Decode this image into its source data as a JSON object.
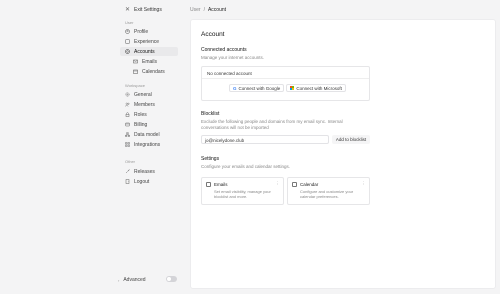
{
  "sidebar": {
    "exit_label": "Exit Settings",
    "user_section": "User",
    "workspace_section": "Workspace",
    "other_section": "Other",
    "items": {
      "profile": "Profile",
      "experience": "Experience",
      "accounts": "Accounts",
      "emails": "Emails",
      "calendars": "Calendars",
      "general": "General",
      "members": "Members",
      "roles": "Roles",
      "billing": "Billing",
      "data_model": "Data model",
      "integrations": "Integrations",
      "releases": "Releases",
      "logout": "Logout"
    },
    "advanced_label": "Advanced",
    "advanced_enabled": false
  },
  "breadcrumb": {
    "parent": "User",
    "separator": "/",
    "current": "Account"
  },
  "main": {
    "title": "Account",
    "connected": {
      "heading": "Connected accounts",
      "description": "Manage your internet accounts.",
      "empty_text": "No connected account",
      "google_button": "Connect with Google",
      "microsoft_button": "Connect with Microsoft"
    },
    "blocklist": {
      "heading": "Blocklist",
      "description_line1": "Exclude the following people and domains from my email sync. Internal",
      "description_line2": "conversations will not be imported",
      "input_value": "jo@nicelydone.club",
      "add_button": "Add to blocklist"
    },
    "settings": {
      "heading": "Settings",
      "description": "Configure your emails and calendar settings.",
      "emails_card": {
        "title": "Emails",
        "desc_line1": "Set email visibility, manage your",
        "desc_line2": "blocklist and more."
      },
      "calendar_card": {
        "title": "Calendar",
        "desc_line1": "Configure and customize your",
        "desc_line2": "calendar preferences."
      }
    }
  },
  "colors": {
    "accent_google": "#4285f4",
    "ms_red": "#f25022",
    "ms_green": "#7fba00",
    "ms_blue": "#00a4ef",
    "ms_yellow": "#ffb900"
  }
}
